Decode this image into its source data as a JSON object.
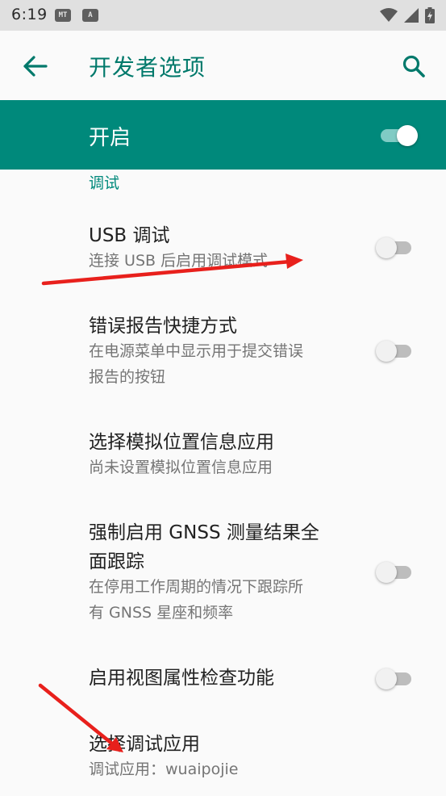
{
  "status_bar": {
    "time": "6:19",
    "chip1": "MT",
    "chip2": "A"
  },
  "app_bar": {
    "title": "开发者选项"
  },
  "master_switch": {
    "label": "开启",
    "on": true
  },
  "section": {
    "header": "调试"
  },
  "prefs": [
    {
      "title": "USB 调试",
      "summary": [
        "连接 USB 后启用调试模式"
      ],
      "toggle": "off"
    },
    {
      "title": "错误报告快捷方式",
      "summary": [
        "在电源菜单中显示用于提交错误",
        "报告的按钮"
      ],
      "toggle": "off"
    },
    {
      "title": "选择模拟位置信息应用",
      "summary": [
        "尚未设置模拟位置信息应用"
      ],
      "toggle": null
    },
    {
      "title_lines": [
        "强制启用 GNSS 测量结果全",
        "面跟踪"
      ],
      "summary": [
        "在停用工作周期的情况下跟踪所",
        "有 GNSS 星座和频率"
      ],
      "toggle": "off"
    },
    {
      "title": "启用视图属性检查功能",
      "summary": [],
      "toggle": "off"
    },
    {
      "title": "选择调试应用",
      "summary": [
        "调试应用：wuaipojie"
      ],
      "toggle": null
    }
  ],
  "colors": {
    "accent": "#00897b",
    "title_teal": "#00796b",
    "annotation_red": "#e8201c"
  }
}
